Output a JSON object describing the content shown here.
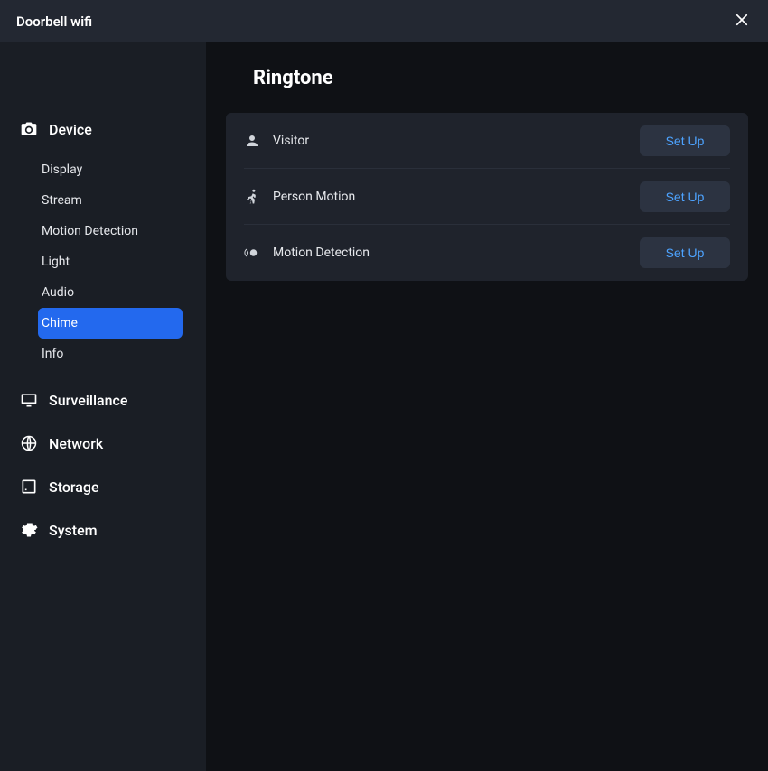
{
  "header": {
    "title": "Doorbell wifi"
  },
  "sidebar": {
    "sections": [
      {
        "label": "Device",
        "icon": "camera-icon",
        "expanded": true,
        "items": [
          {
            "label": "Display",
            "active": false
          },
          {
            "label": "Stream",
            "active": false
          },
          {
            "label": "Motion Detection",
            "active": false
          },
          {
            "label": "Light",
            "active": false
          },
          {
            "label": "Audio",
            "active": false
          },
          {
            "label": "Chime",
            "active": true
          },
          {
            "label": "Info",
            "active": false
          }
        ]
      },
      {
        "label": "Surveillance",
        "icon": "monitor-icon",
        "expanded": false
      },
      {
        "label": "Network",
        "icon": "globe-icon",
        "expanded": false
      },
      {
        "label": "Storage",
        "icon": "disk-icon",
        "expanded": false
      },
      {
        "label": "System",
        "icon": "gear-icon",
        "expanded": false
      }
    ]
  },
  "page": {
    "title": "Ringtone",
    "rows": [
      {
        "icon": "person-icon",
        "label": "Visitor",
        "button": "Set Up"
      },
      {
        "icon": "running-icon",
        "label": "Person Motion",
        "button": "Set Up"
      },
      {
        "icon": "motion-ball-icon",
        "label": "Motion Detection",
        "button": "Set Up"
      }
    ]
  }
}
